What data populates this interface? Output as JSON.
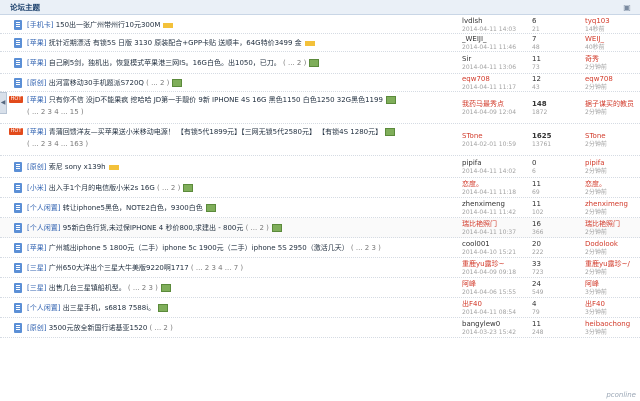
{
  "header": {
    "title": "论坛主题"
  },
  "threads": [
    {
      "tag": "[手机卡]",
      "text": "150出一张广州带州行10元300M",
      "pages": "",
      "pic": false,
      "new": true,
      "author": "lvdlsh",
      "date": "2014-04-11 14:03",
      "replies": "6",
      "views": "21",
      "last": "tyq103",
      "last_time": "14秒前",
      "icon": "doc",
      "red_author": false
    },
    {
      "tag": "[苹果]",
      "text": "抚针近期漂活 有锁5S 日版 3130 原装配合+GPP卡贴 送顺丰，64G特价3499 金",
      "pages": "",
      "pic": false,
      "new": true,
      "author": "_WEIJI_",
      "date": "2014-04-11 11:46",
      "replies": "7",
      "views": "48",
      "last": "WEIJ_",
      "last_time": "40秒前",
      "icon": "doc",
      "red_author": false
    },
    {
      "tag": "[苹果]",
      "text": "自己刷5剑，独机出，恢复模式苹果港三网IS。16G白色。出1050，已刀。",
      "pages": "( ... 2 )",
      "pic": true,
      "new": false,
      "author": "Sir",
      "date": "2014-04-11 13:06",
      "replies": "11",
      "views": "73",
      "last": "奇秀",
      "last_time": "2分钟前",
      "icon": "doc",
      "red_author": false
    },
    {
      "tag": "[原创]",
      "text": "出河富移动30手机题派S720Q",
      "pages": "( ... 2 )",
      "pic": true,
      "new": false,
      "author": "eqw708",
      "date": "2014-04-11 11:17",
      "replies": "12",
      "views": "43",
      "last": "eqw708",
      "last_time": "2分钟前",
      "icon": "doc",
      "red_author": true
    },
    {
      "tag": "[苹果]",
      "text": "只有你不信 没jD不能果疯 挖哈哈 JD第一手靓价 9新 IPHONE 4S 16G 黑色1150 白色1250 32G黑色1199",
      "pages": "( ... 2 3 4 ... 15 )",
      "pic": true,
      "new": false,
      "author": "我药马最秀点",
      "date": "2014-04-09 12:04",
      "replies": "148",
      "views": "1872",
      "last": "据子谋买的教员",
      "last_time": "2分钟前",
      "icon": "hot",
      "red_author": true,
      "stats_bold": true
    },
    {
      "tag": "[苹果]",
      "text": "青蒲回馈洋友—买苹果送小米移动电源！ 【有锁5代1899元】【三网无锁5代2580元】 【有锁4S 1280元】",
      "pages": "( ... 2 3 4 ... 163 )",
      "pic": true,
      "new": false,
      "author": "STone",
      "date": "2014-02-01 10:59",
      "replies": "1625",
      "views": "13761",
      "last": "STone",
      "last_time": "2分钟前",
      "icon": "hot",
      "red_author": true,
      "stats_bold": true
    },
    {
      "tag": "[原创]",
      "text": "索尼 sony x139h",
      "pages": "",
      "pic": false,
      "new": true,
      "author": "pipifa",
      "date": "2014-04-11 14:02",
      "replies": "0",
      "views": "6",
      "last": "pipifa",
      "last_time": "2分钟前",
      "icon": "doc",
      "red_author": false
    },
    {
      "tag": "[小米]",
      "text": "出入手1个月的电信版小米2s 16G",
      "pages": "( ... 2 )",
      "pic": true,
      "new": false,
      "author": "恋度。",
      "date": "2014-04-11 11:18",
      "replies": "11",
      "views": "69",
      "last": "恋度。",
      "last_time": "2分钟前",
      "icon": "doc",
      "red_author": true
    },
    {
      "tag": "[个人闲置]",
      "text": "转让iphone5黑色，NOTE2白色，9300白色",
      "pages": "",
      "pic": true,
      "new": false,
      "author": "zhenximeng",
      "date": "2014-04-11 11:42",
      "replies": "11",
      "views": "102",
      "last": "zhenximeng",
      "last_time": "2分钟前",
      "icon": "doc",
      "red_author": false
    },
    {
      "tag": "[个人闲置]",
      "text": "95新白色行货,未过保IPHONE 4 秒价800,求建出 - 800元",
      "pages": "( ... 2 )",
      "pic": true,
      "new": false,
      "author": "瑞比艳照门",
      "date": "2014-04-11 10:37",
      "replies": "16",
      "views": "366",
      "last": "瑞比艳照门",
      "last_time": "2分钟前",
      "icon": "doc",
      "red_author": true,
      "hl": true
    },
    {
      "tag": "[苹果]",
      "text": "广州城出iphone 5 1800元（二手）iphone 5c 1900元（二手）iphone 5S 2950（激活几天）",
      "pages": "( ... 2 3 )",
      "pic": false,
      "new": false,
      "author": "cool001",
      "date": "2014-04-10 15:21",
      "replies": "20",
      "views": "222",
      "last": "Dodolook",
      "last_time": "2分钟前",
      "icon": "doc",
      "red_author": false
    },
    {
      "tag": "[三星]",
      "text": "广州650大洋出个三星大牛美版9220啊1717",
      "pages": "( ... 2 3 4 ... 7 )",
      "pic": false,
      "new": false,
      "author": "重鹿yu露珍~",
      "date": "2014-04-09 09:18",
      "replies": "33",
      "views": "723",
      "last": "重鹿yu露珍~/",
      "last_time": "2分钟前",
      "icon": "doc",
      "red_author": true
    },
    {
      "tag": "[三星]",
      "text": "出售几台三星镇船机型。",
      "pages": "( ... 2 3 )",
      "pic": true,
      "new": false,
      "author": "阿峰",
      "date": "2014-04-06 15:55",
      "replies": "24",
      "views": "549",
      "last": "阿峰",
      "last_time": "3分钟前",
      "icon": "doc",
      "red_author": true
    },
    {
      "tag": "[个人闲置]",
      "text": "出三星手机，s6818 7588i。",
      "pages": "",
      "pic": true,
      "new": false,
      "author": "出F40",
      "date": "2014-04-11 08:54",
      "replies": "4",
      "views": "79",
      "last": "出F40",
      "last_time": "3分钟前",
      "icon": "doc",
      "red_author": true
    },
    {
      "tag": "[原创]",
      "text": "3500元放全新国行诺基亚1520",
      "pages": "( ... 2 )",
      "pic": false,
      "new": false,
      "author": "bangylew0",
      "date": "2014-03-23 15:42",
      "replies": "11",
      "views": "248",
      "last": "heibaochong",
      "last_time": "3分钟前",
      "icon": "doc",
      "red_author": false
    }
  ],
  "side_tab": {
    "label": "◀"
  },
  "watermark": "pconline"
}
